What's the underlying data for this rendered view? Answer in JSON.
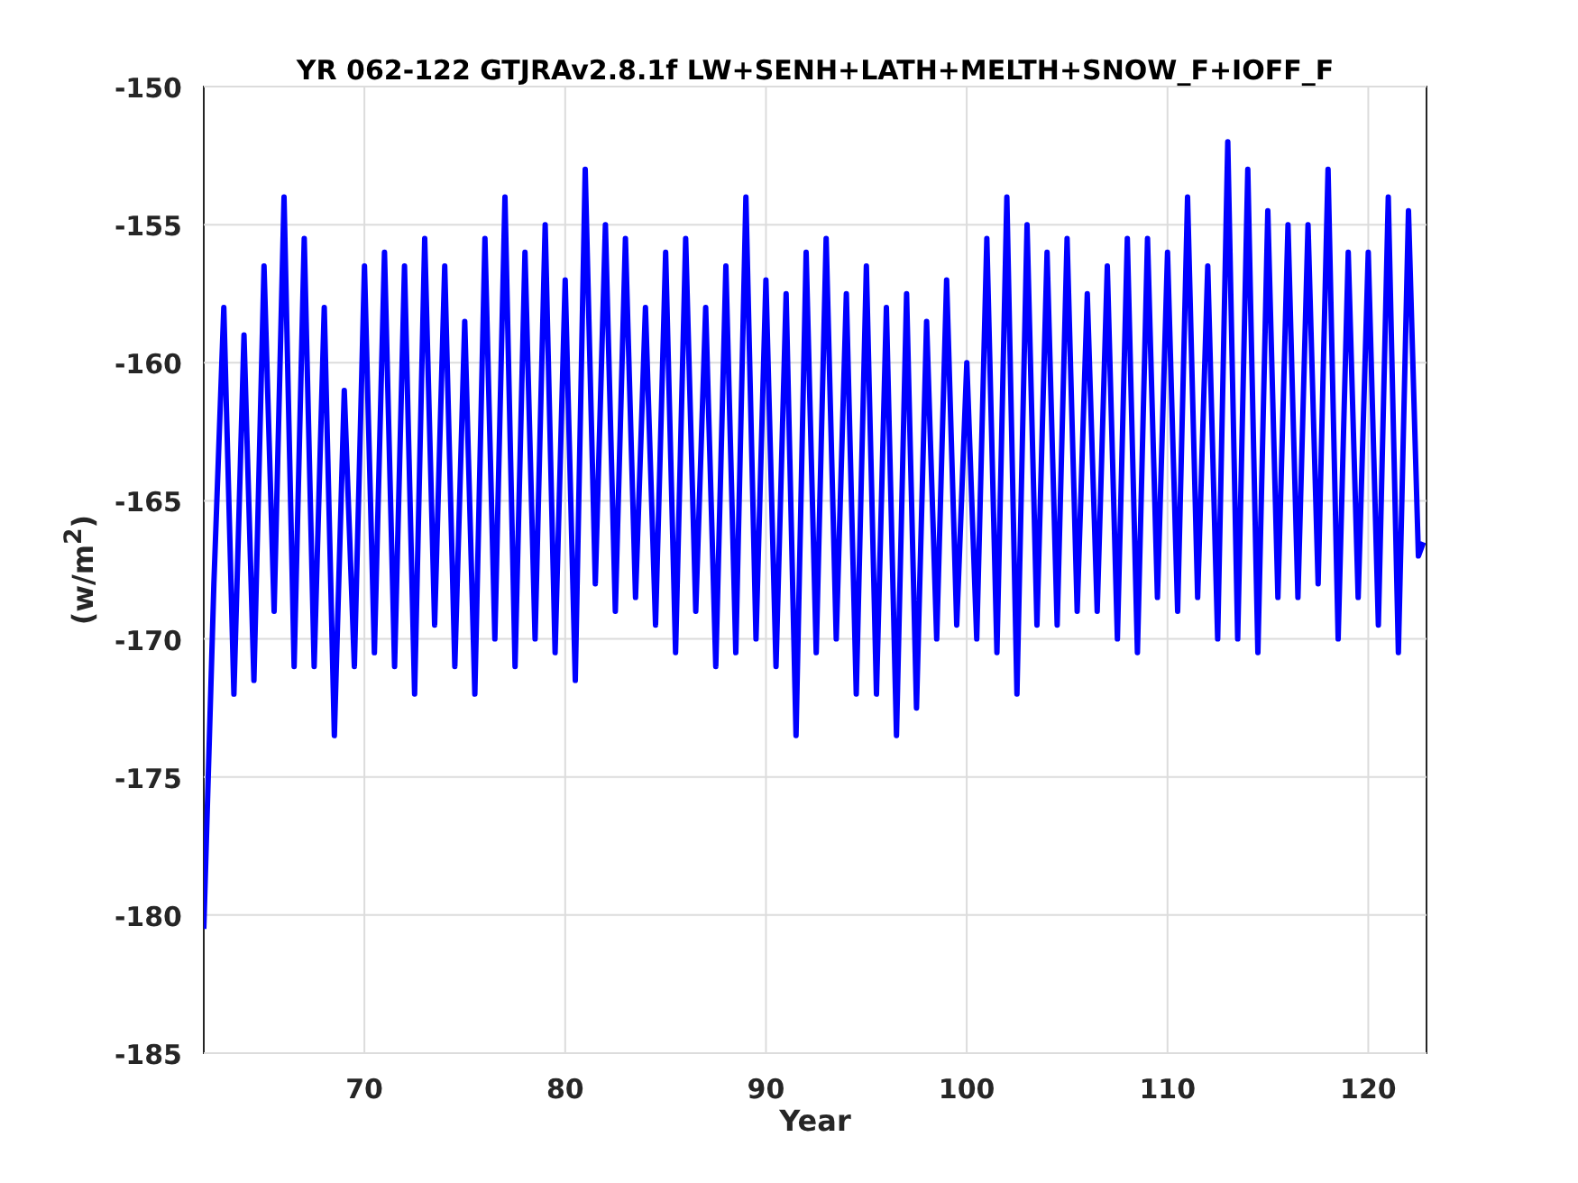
{
  "figure": {
    "chart_data": {
      "type": "line",
      "grid": true,
      "title": "YR 062-122 GTJRAv2.8.1f LW+SENH+LATH+MELTH+SNOW_F+IOFF_F",
      "xlabel": "Year",
      "ylabel": "(w/m$^{2}$)",
      "xlim": [
        62,
        122.9
      ],
      "ylim": [
        -185,
        -150
      ],
      "xticks": [
        70,
        80,
        90,
        100,
        110,
        120
      ],
      "yticks": [
        -185,
        -180,
        -175,
        -170,
        -165,
        -160,
        -155,
        -150
      ],
      "x": [
        62,
        62.5,
        63,
        63.5,
        64,
        64.5,
        65,
        65.5,
        66,
        66.5,
        67,
        67.5,
        68,
        68.5,
        69,
        69.5,
        70,
        70.5,
        71,
        71.5,
        72,
        72.5,
        73,
        73.5,
        74,
        74.5,
        75,
        75.5,
        76,
        76.5,
        77,
        77.5,
        78,
        78.5,
        79,
        79.5,
        80,
        80.5,
        81,
        81.5,
        82,
        82.5,
        83,
        83.5,
        84,
        84.5,
        85,
        85.5,
        86,
        86.5,
        87,
        87.5,
        88,
        88.5,
        89,
        89.5,
        90,
        90.5,
        91,
        91.5,
        92,
        92.5,
        93,
        93.5,
        94,
        94.5,
        95,
        95.5,
        96,
        96.5,
        97,
        97.5,
        98,
        98.5,
        99,
        99.5,
        100,
        100.5,
        101,
        101.5,
        102,
        102.5,
        103,
        103.5,
        104,
        104.5,
        105,
        105.5,
        106,
        106.5,
        107,
        107.5,
        108,
        108.5,
        109,
        109.5,
        110,
        110.5,
        111,
        111.5,
        112,
        112.5,
        113,
        113.5,
        114,
        114.5,
        115,
        115.5,
        116,
        116.5,
        117,
        117.5,
        118,
        118.5,
        119,
        119.5,
        120,
        120.5,
        121,
        121.5,
        122,
        122.5,
        122.75
      ],
      "series": [
        {
          "color": "#0000ff",
          "values": [
            -180.5,
            -168,
            -158,
            -172,
            -159,
            -171.5,
            -156.5,
            -169,
            -154,
            -171,
            -155.5,
            -171,
            -158,
            -173.5,
            -161,
            -171,
            -156.5,
            -170.5,
            -156,
            -171,
            -156.5,
            -172,
            -155.5,
            -169.5,
            -156.5,
            -171,
            -158.5,
            -172,
            -155.5,
            -170,
            -154,
            -171,
            -156,
            -170,
            -155,
            -170.5,
            -157,
            -171.5,
            -153,
            -168,
            -155,
            -169,
            -155.5,
            -168.5,
            -158,
            -169.5,
            -156,
            -170.5,
            -155.5,
            -169,
            -158,
            -171,
            -156.5,
            -170.5,
            -154,
            -170,
            -157,
            -171,
            -157.5,
            -173.5,
            -156,
            -170.5,
            -155.5,
            -170,
            -157.5,
            -172,
            -156.5,
            -172,
            -158,
            -173.5,
            -157.5,
            -172.5,
            -158.5,
            -170,
            -157,
            -169.5,
            -160,
            -170,
            -155.5,
            -170.5,
            -154,
            -172,
            -155,
            -169.5,
            -156,
            -169.5,
            -155.5,
            -169,
            -157.5,
            -169,
            -156.5,
            -170,
            -155.5,
            -170.5,
            -155.5,
            -168.5,
            -156,
            -169,
            -154,
            -168.5,
            -156.5,
            -170,
            -152,
            -170,
            -153,
            -170.5,
            -154.5,
            -168.5,
            -155,
            -168.5,
            -155,
            -168,
            -153,
            -170,
            -156,
            -168.5,
            -156,
            -169.5,
            -154,
            -170.5,
            -154.5,
            -167,
            -166.5
          ]
        }
      ]
    }
  }
}
